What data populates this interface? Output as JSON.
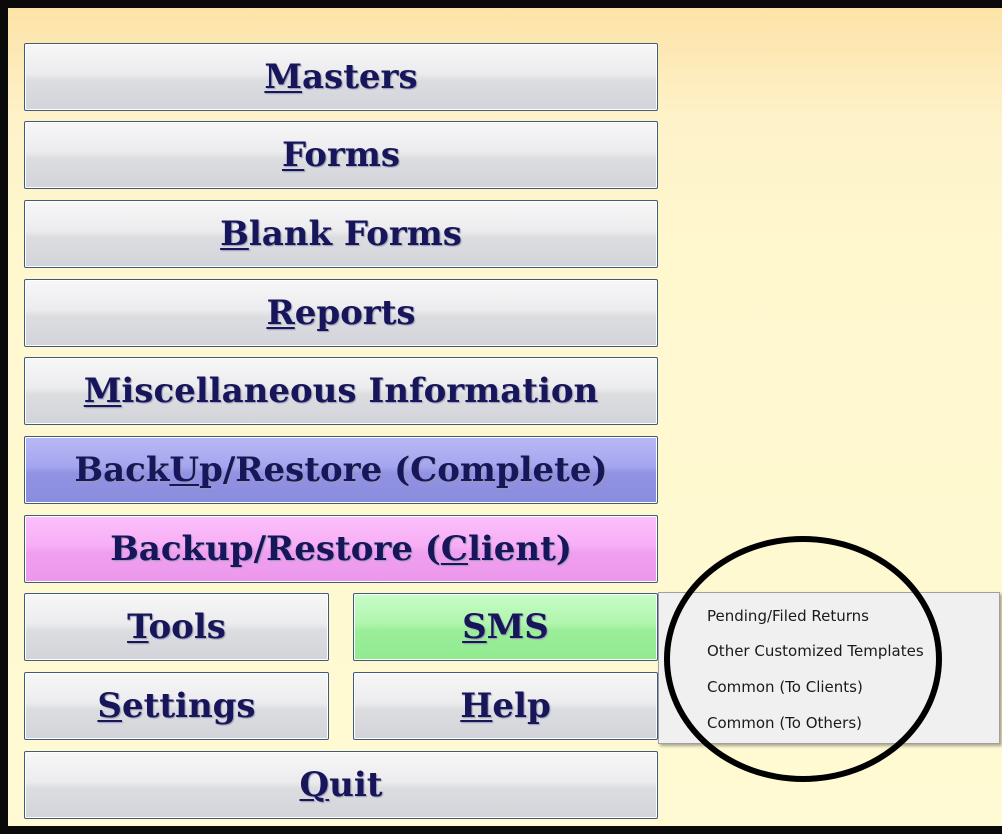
{
  "menu": {
    "masters": {
      "pre": "",
      "ul": "M",
      "post": "asters"
    },
    "forms": {
      "pre": "",
      "ul": "F",
      "post": "orms"
    },
    "blank_forms": {
      "pre": "",
      "ul": "B",
      "post": "lank Forms"
    },
    "reports": {
      "pre": "",
      "ul": "R",
      "post": "eports"
    },
    "misc": {
      "pre": "",
      "ul": "M",
      "post": "iscellaneous Information"
    },
    "backup_complete": {
      "pre": "Back",
      "ul": "U",
      "post": "p/Restore (Complete)"
    },
    "backup_client": {
      "pre": "Backup/Restore (",
      "ul": "C",
      "post": "lient)"
    },
    "tools": {
      "pre": "",
      "ul": "T",
      "post": "ools"
    },
    "sms": {
      "pre": "",
      "ul": "S",
      "post": "MS"
    },
    "settings": {
      "pre": "",
      "ul": "S",
      "post": "ettings"
    },
    "help": {
      "pre": "",
      "ul": "H",
      "post": "elp"
    },
    "quit": {
      "pre": "",
      "ul": "Q",
      "post": "uit"
    }
  },
  "sms_menu": {
    "items": [
      {
        "label": "Pending/Filed Returns"
      },
      {
        "label": "Other Customized Templates"
      },
      {
        "label": "Common (To Clients)"
      },
      {
        "label": "Common (To Others)"
      }
    ]
  },
  "colors": {
    "button_text": "#17165a",
    "backup_complete_bg": "#a4a5ee",
    "backup_client_bg": "#f7aef5",
    "sms_bg": "#b0f5ad",
    "window_bg": "#fff8cf"
  }
}
